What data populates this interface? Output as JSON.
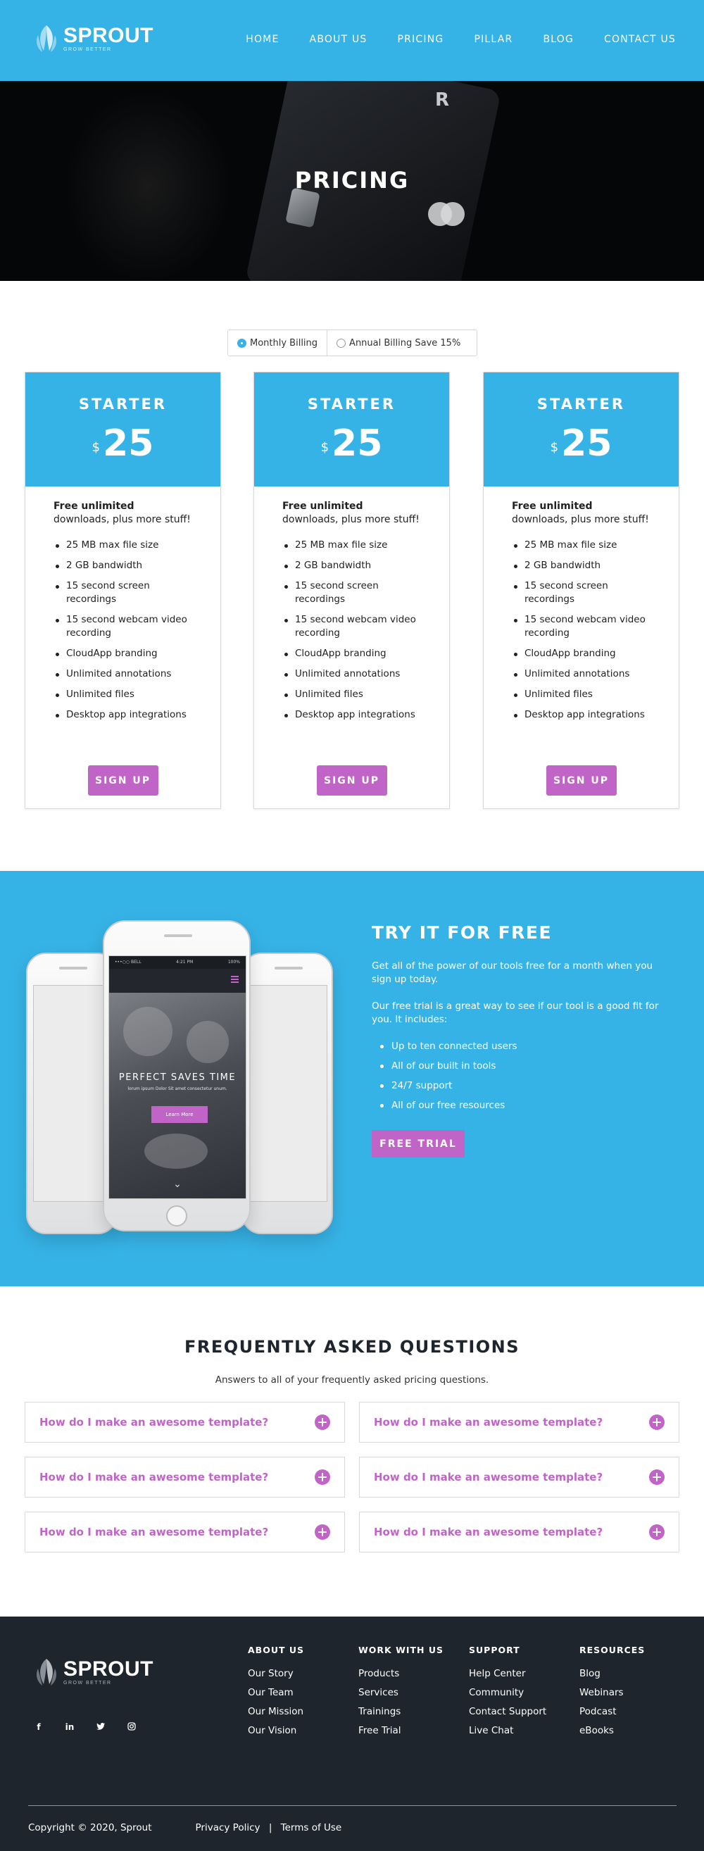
{
  "brand": {
    "name": "SPROUT",
    "tagline": "GROW BETTER"
  },
  "nav": [
    "HOME",
    "ABOUT US",
    "PRICING",
    "PILLAR",
    "BLOG",
    "CONTACT US"
  ],
  "hero": {
    "title": "PRICING"
  },
  "billing": {
    "monthly": "Monthly Billing",
    "annual": "Annual Billing Save 15%",
    "selected": "monthly"
  },
  "plans": [
    {
      "name": "STARTER",
      "currency": "$",
      "price": "25",
      "intro_bold": "Free unlimited",
      "intro_rest": " downloads, plus more stuff!",
      "features": [
        "25 MB max file size",
        "2 GB bandwidth",
        "15 second screen recordings",
        "15 second webcam video recording",
        "CloudApp branding",
        "Unlimited annotations",
        "Unlimited files",
        "Desktop app integrations"
      ],
      "cta": "SIGN UP"
    },
    {
      "name": "STARTER",
      "currency": "$",
      "price": "25",
      "intro_bold": "Free unlimited",
      "intro_rest": " downloads, plus more stuff!",
      "features": [
        "25 MB max file size",
        "2 GB bandwidth",
        "15 second screen recordings",
        "15 second webcam video recording",
        "CloudApp branding",
        "Unlimited annotations",
        "Unlimited files",
        "Desktop app integrations"
      ],
      "cta": "SIGN UP"
    },
    {
      "name": "STARTER",
      "currency": "$",
      "price": "25",
      "intro_bold": "Free unlimited",
      "intro_rest": " downloads, plus more stuff!",
      "features": [
        "25 MB max file size",
        "2 GB bandwidth",
        "15 second screen recordings",
        "15 second webcam video recording",
        "CloudApp branding",
        "Unlimited annotations",
        "Unlimited files",
        "Desktop app integrations"
      ],
      "cta": "SIGN UP"
    }
  ],
  "trial": {
    "title": "TRY IT FOR FREE",
    "p1": "Get all of the power of our tools free for a month when you sign up today.",
    "p2": "Our free trial is a great way to see if our tool is a good fit for you. It includes:",
    "items": [
      "Up to ten connected users",
      "All of our built in tools",
      "24/7 support",
      "All of our free resources"
    ],
    "cta": "FREE TRIAL",
    "phone": {
      "carrier": "•••○○ BELL",
      "time": "4:21 PM",
      "battery": "100%",
      "title": "PERFECT SAVES TIME",
      "subtitle": "lorum ipsum Dolor Sit amet consectetur unum.",
      "button": "Learn More"
    }
  },
  "faq": {
    "title": "FREQUENTLY ASKED QUESTIONS",
    "subtitle": "Answers to all of your frequently asked pricing questions.",
    "items": [
      "How do I make an awesome template?",
      "How do I make an awesome template?",
      "How do I make an awesome template?",
      "How do I make an awesome template?",
      "How do I make an awesome template?",
      "How do I make an awesome template?"
    ]
  },
  "footer": {
    "socials": [
      "f",
      "in",
      "tw",
      "ig"
    ],
    "columns": [
      {
        "title": "ABOUT US",
        "links": [
          "Our Story",
          "Our Team",
          "Our Mission",
          "Our Vision"
        ]
      },
      {
        "title": "WORK WITH US",
        "links": [
          "Products",
          "Services",
          "Trainings",
          "Free Trial"
        ]
      },
      {
        "title": "SUPPORT",
        "links": [
          "Help Center",
          "Community",
          "Contact Support",
          "Live Chat"
        ]
      },
      {
        "title": "RESOURCES",
        "links": [
          "Blog",
          "Webinars",
          "Podcast",
          "eBooks"
        ]
      }
    ],
    "copyright": "Copyright © 2020, Sprout",
    "privacy": "Privacy Policy",
    "separator": "|",
    "terms": "Terms of Use"
  },
  "colors": {
    "primary": "#36b3e6",
    "accent": "#c164c8",
    "dark": "#1e252c"
  }
}
